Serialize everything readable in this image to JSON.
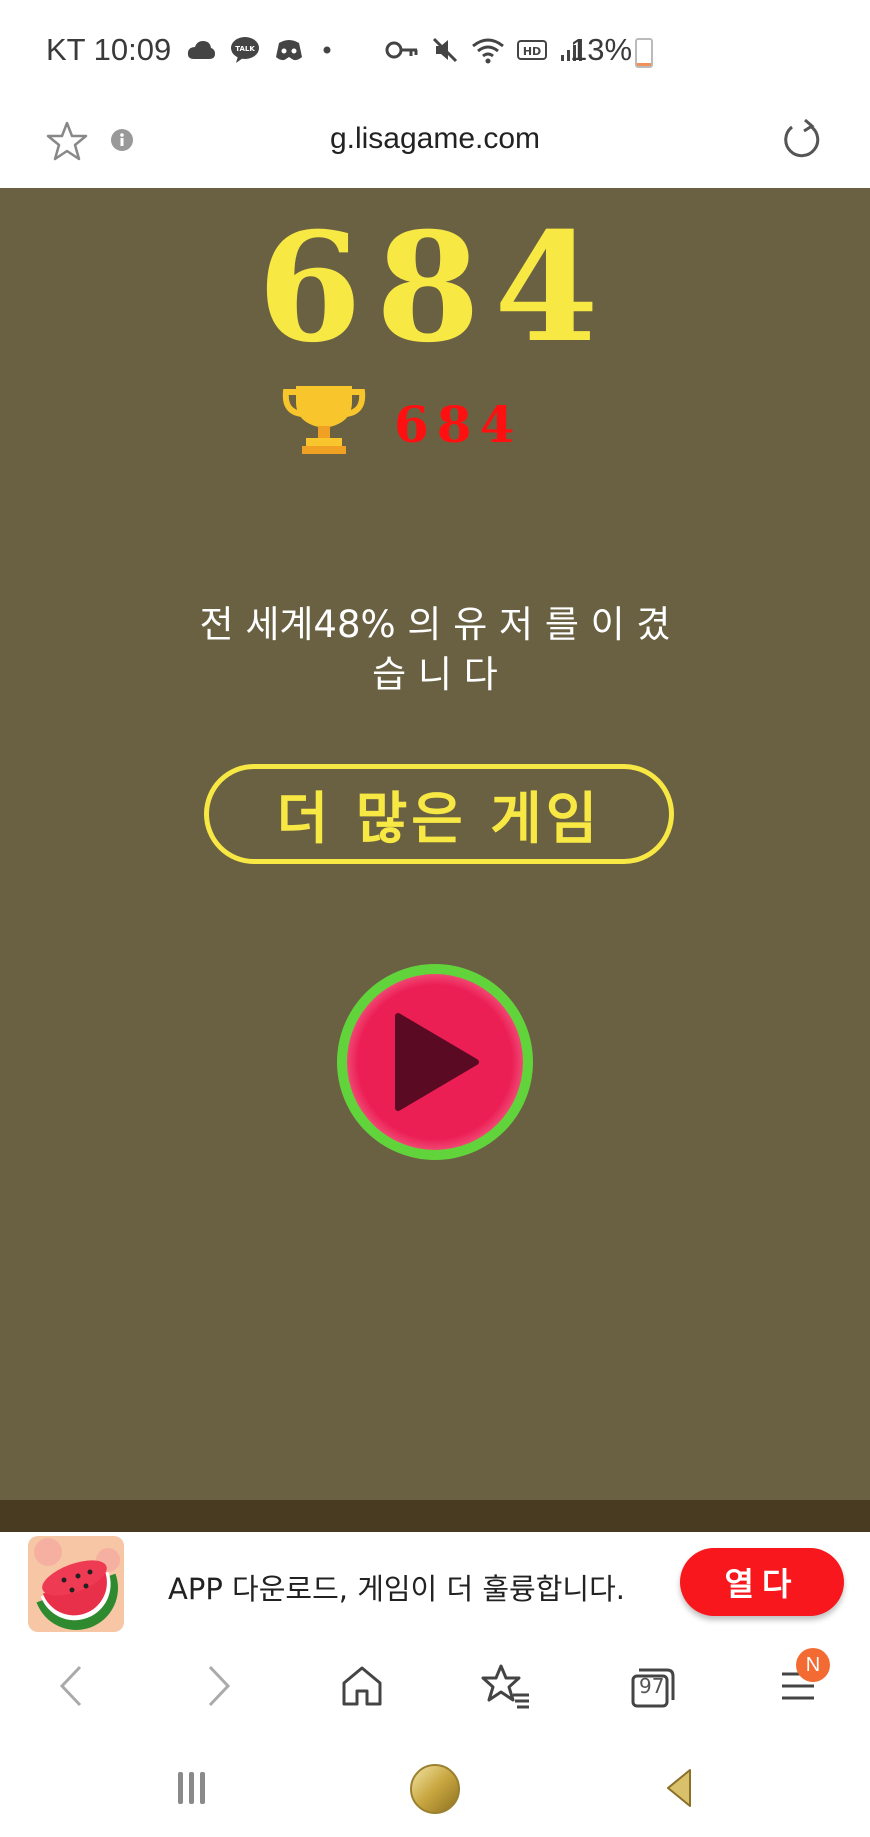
{
  "status_bar": {
    "carrier_time": "KT 10:09",
    "battery": "13%",
    "battery_level": 0.13,
    "left_icons": [
      "cloud-icon",
      "kakaotalk-icon",
      "discord-icon",
      "dot-icon"
    ],
    "right_icons": [
      "key-icon",
      "mute-icon",
      "wifi-icon",
      "hd-icon",
      "signal-icon"
    ]
  },
  "url_bar": {
    "url": "g.lisagame.com",
    "icons": [
      "star-icon",
      "info-icon",
      "refresh-icon"
    ]
  },
  "game": {
    "score": "684",
    "best_score": "684",
    "rank_line1": "전 세계48% 의 유 저 를 이 겼",
    "rank_line2": "습 니 다",
    "more_games_label": "더 많은 게임",
    "colors": {
      "background": "#6a6143",
      "score": "#f8e844",
      "best_score": "#ff1010",
      "play_ring": "#62d43b",
      "play_fill": "#ec1f55"
    }
  },
  "banner": {
    "text": "APP 다운로드, 게임이 더 훌륭합니다.",
    "open_label": "열다",
    "icon": "watermelon-icon"
  },
  "browser_nav": {
    "tabs_count": "97",
    "menu_badge": "N",
    "icons": [
      "back-icon",
      "forward-icon",
      "home-icon",
      "bookmarks-icon",
      "tabs-icon",
      "menu-icon"
    ]
  },
  "system_nav": {
    "icons": [
      "recents-icon",
      "home-button-icon",
      "back-button-icon"
    ]
  }
}
